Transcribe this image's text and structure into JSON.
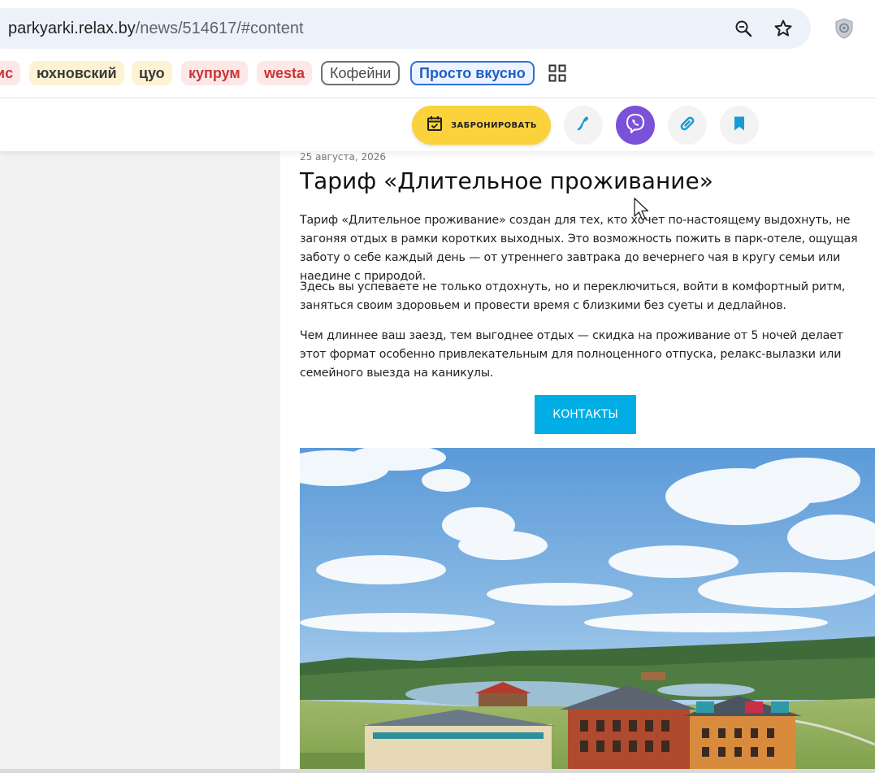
{
  "browser": {
    "url_host": "parkyarki.relax.by",
    "url_path": "/news/514617/#content",
    "icons": [
      "zoom-icon",
      "bookmark-star-icon",
      "extension-shield-icon"
    ]
  },
  "bookmarks": [
    {
      "label": "ис",
      "style": "red"
    },
    {
      "label": "юхновский",
      "style": "yellow"
    },
    {
      "label": "цуо",
      "style": "yellow"
    },
    {
      "label": "купрум",
      "style": "red"
    },
    {
      "label": "westa",
      "style": "red"
    },
    {
      "label": "Кофейни",
      "style": "outline-gray"
    },
    {
      "label": "Просто вкусно",
      "style": "outline-blue"
    }
  ],
  "header": {
    "book_label": "ЗАБРОНИРОВАТЬ",
    "accent_yellow": "#fbd23c",
    "viber_color": "#7b51d9",
    "link_blue": "#1a9bd7"
  },
  "article": {
    "date": "25 августа, 2026",
    "title": "Тариф «Длительное проживание»",
    "paragraphs": [
      "Тариф «Длительное проживание» создан для тех, кто хочет по-настоящему выдохнуть, не загоняя отдых в рамки коротких выходных. Это возможность пожить в парк-отеле, ощущая заботу о себе каждый день — от утреннего завтрака до вечернего чая в кругу семьи или наедине с природой.",
      "Здесь вы успеваете не только отдохнуть, но и переключиться, войти в комфортный ритм, заняться своим здоровьем и провести время с близкими без суеты и дедлайнов.",
      "Чем длиннее ваш заезд, тем выгоднее отдых — скидка на проживание от 5 ночей делает этот формат особенно привлекательным для полноценного отпуска, релакс-вылазки или семейного выезда на каникулы."
    ],
    "contacts_label": "КОНТАКТЫ",
    "contacts_color": "#00aee5"
  }
}
